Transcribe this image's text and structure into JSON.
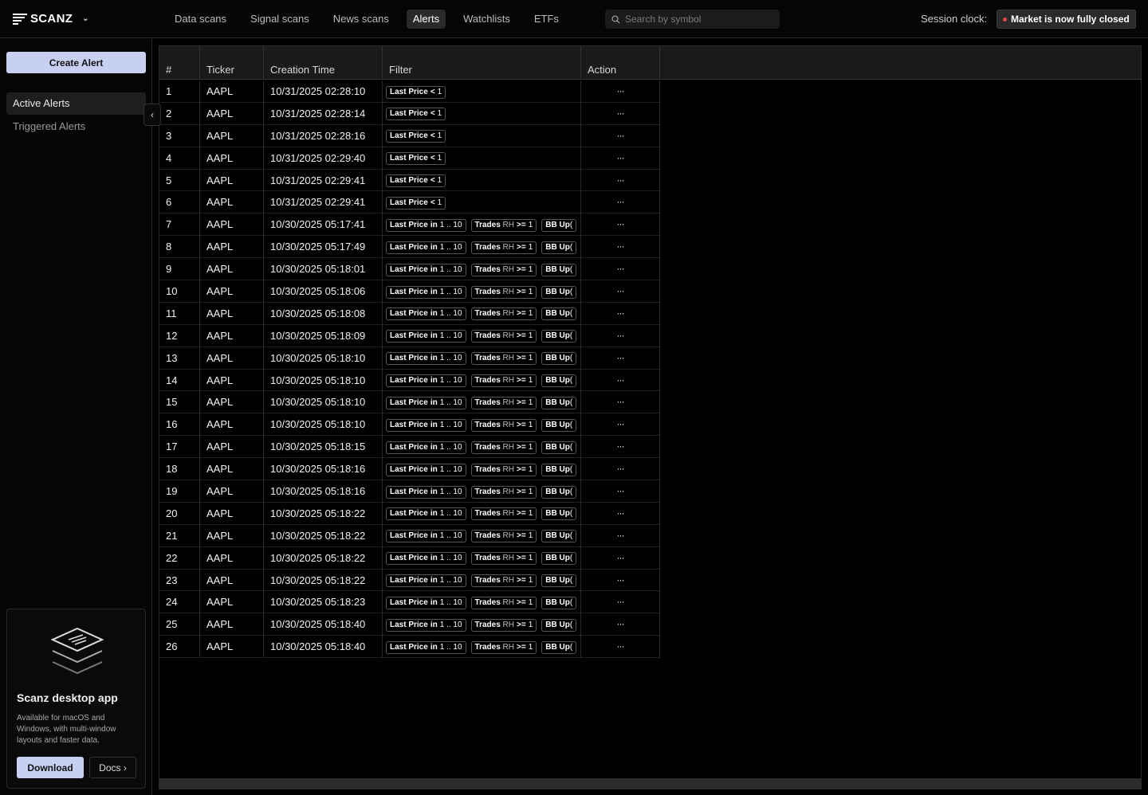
{
  "brand": {
    "name": "SCANZ"
  },
  "nav": {
    "tabs": [
      {
        "label": "Data scans",
        "active": false
      },
      {
        "label": "Signal scans",
        "active": false
      },
      {
        "label": "News scans",
        "active": false
      },
      {
        "label": "Alerts",
        "active": true
      },
      {
        "label": "Watchlists",
        "active": false
      },
      {
        "label": "ETFs",
        "active": false
      }
    ]
  },
  "search": {
    "placeholder": "Search by symbol"
  },
  "session": {
    "label": "Session clock:",
    "status": "Market is now fully closed",
    "status_color": "#e5484d"
  },
  "sidebar": {
    "create_label": "Create Alert",
    "items": [
      {
        "label": "Active Alerts",
        "active": true
      },
      {
        "label": "Triggered Alerts",
        "active": false
      }
    ],
    "collapse_icon": "chevron-left-icon"
  },
  "promo": {
    "title": "Scanz desktop app",
    "text": "Available for macOS and Windows, with multi-window layouts and faster data.",
    "download_label": "Download",
    "docs_label": "Docs ›"
  },
  "table": {
    "columns": [
      "#",
      "Ticker",
      "Creation Time",
      "Filter",
      "Action"
    ],
    "action_label": "···",
    "filter_sets": {
      "simple": [
        {
          "name": "Last Price",
          "op": "<",
          "value": "1"
        }
      ],
      "complex": [
        {
          "name": "Last Price",
          "op": "in",
          "value": "1 .. 10"
        },
        {
          "name": "Trades",
          "qual": "RH",
          "op": ">=",
          "value": "1"
        },
        {
          "name": "BB Up",
          "op": "",
          "value": "("
        }
      ]
    },
    "rows": [
      {
        "n": "1",
        "ticker": "AAPL",
        "time": "10/31/2025 02:28:10",
        "filter": "simple"
      },
      {
        "n": "2",
        "ticker": "AAPL",
        "time": "10/31/2025 02:28:14",
        "filter": "simple"
      },
      {
        "n": "3",
        "ticker": "AAPL",
        "time": "10/31/2025 02:28:16",
        "filter": "simple"
      },
      {
        "n": "4",
        "ticker": "AAPL",
        "time": "10/31/2025 02:29:40",
        "filter": "simple"
      },
      {
        "n": "5",
        "ticker": "AAPL",
        "time": "10/31/2025 02:29:41",
        "filter": "simple"
      },
      {
        "n": "6",
        "ticker": "AAPL",
        "time": "10/31/2025 02:29:41",
        "filter": "simple"
      },
      {
        "n": "7",
        "ticker": "AAPL",
        "time": "10/30/2025 05:17:41",
        "filter": "complex"
      },
      {
        "n": "8",
        "ticker": "AAPL",
        "time": "10/30/2025 05:17:49",
        "filter": "complex"
      },
      {
        "n": "9",
        "ticker": "AAPL",
        "time": "10/30/2025 05:18:01",
        "filter": "complex"
      },
      {
        "n": "10",
        "ticker": "AAPL",
        "time": "10/30/2025 05:18:06",
        "filter": "complex"
      },
      {
        "n": "11",
        "ticker": "AAPL",
        "time": "10/30/2025 05:18:08",
        "filter": "complex"
      },
      {
        "n": "12",
        "ticker": "AAPL",
        "time": "10/30/2025 05:18:09",
        "filter": "complex"
      },
      {
        "n": "13",
        "ticker": "AAPL",
        "time": "10/30/2025 05:18:10",
        "filter": "complex"
      },
      {
        "n": "14",
        "ticker": "AAPL",
        "time": "10/30/2025 05:18:10",
        "filter": "complex"
      },
      {
        "n": "15",
        "ticker": "AAPL",
        "time": "10/30/2025 05:18:10",
        "filter": "complex"
      },
      {
        "n": "16",
        "ticker": "AAPL",
        "time": "10/30/2025 05:18:10",
        "filter": "complex"
      },
      {
        "n": "17",
        "ticker": "AAPL",
        "time": "10/30/2025 05:18:15",
        "filter": "complex"
      },
      {
        "n": "18",
        "ticker": "AAPL",
        "time": "10/30/2025 05:18:16",
        "filter": "complex"
      },
      {
        "n": "19",
        "ticker": "AAPL",
        "time": "10/30/2025 05:18:16",
        "filter": "complex"
      },
      {
        "n": "20",
        "ticker": "AAPL",
        "time": "10/30/2025 05:18:22",
        "filter": "complex"
      },
      {
        "n": "21",
        "ticker": "AAPL",
        "time": "10/30/2025 05:18:22",
        "filter": "complex"
      },
      {
        "n": "22",
        "ticker": "AAPL",
        "time": "10/30/2025 05:18:22",
        "filter": "complex"
      },
      {
        "n": "23",
        "ticker": "AAPL",
        "time": "10/30/2025 05:18:22",
        "filter": "complex"
      },
      {
        "n": "24",
        "ticker": "AAPL",
        "time": "10/30/2025 05:18:23",
        "filter": "complex"
      },
      {
        "n": "25",
        "ticker": "AAPL",
        "time": "10/30/2025 05:18:40",
        "filter": "complex"
      },
      {
        "n": "26",
        "ticker": "AAPL",
        "time": "10/30/2025 05:18:40",
        "filter": "complex"
      }
    ]
  },
  "colors": {
    "accent": "#c7d0f0",
    "background": "#000000",
    "header": "#1a1a1a"
  }
}
